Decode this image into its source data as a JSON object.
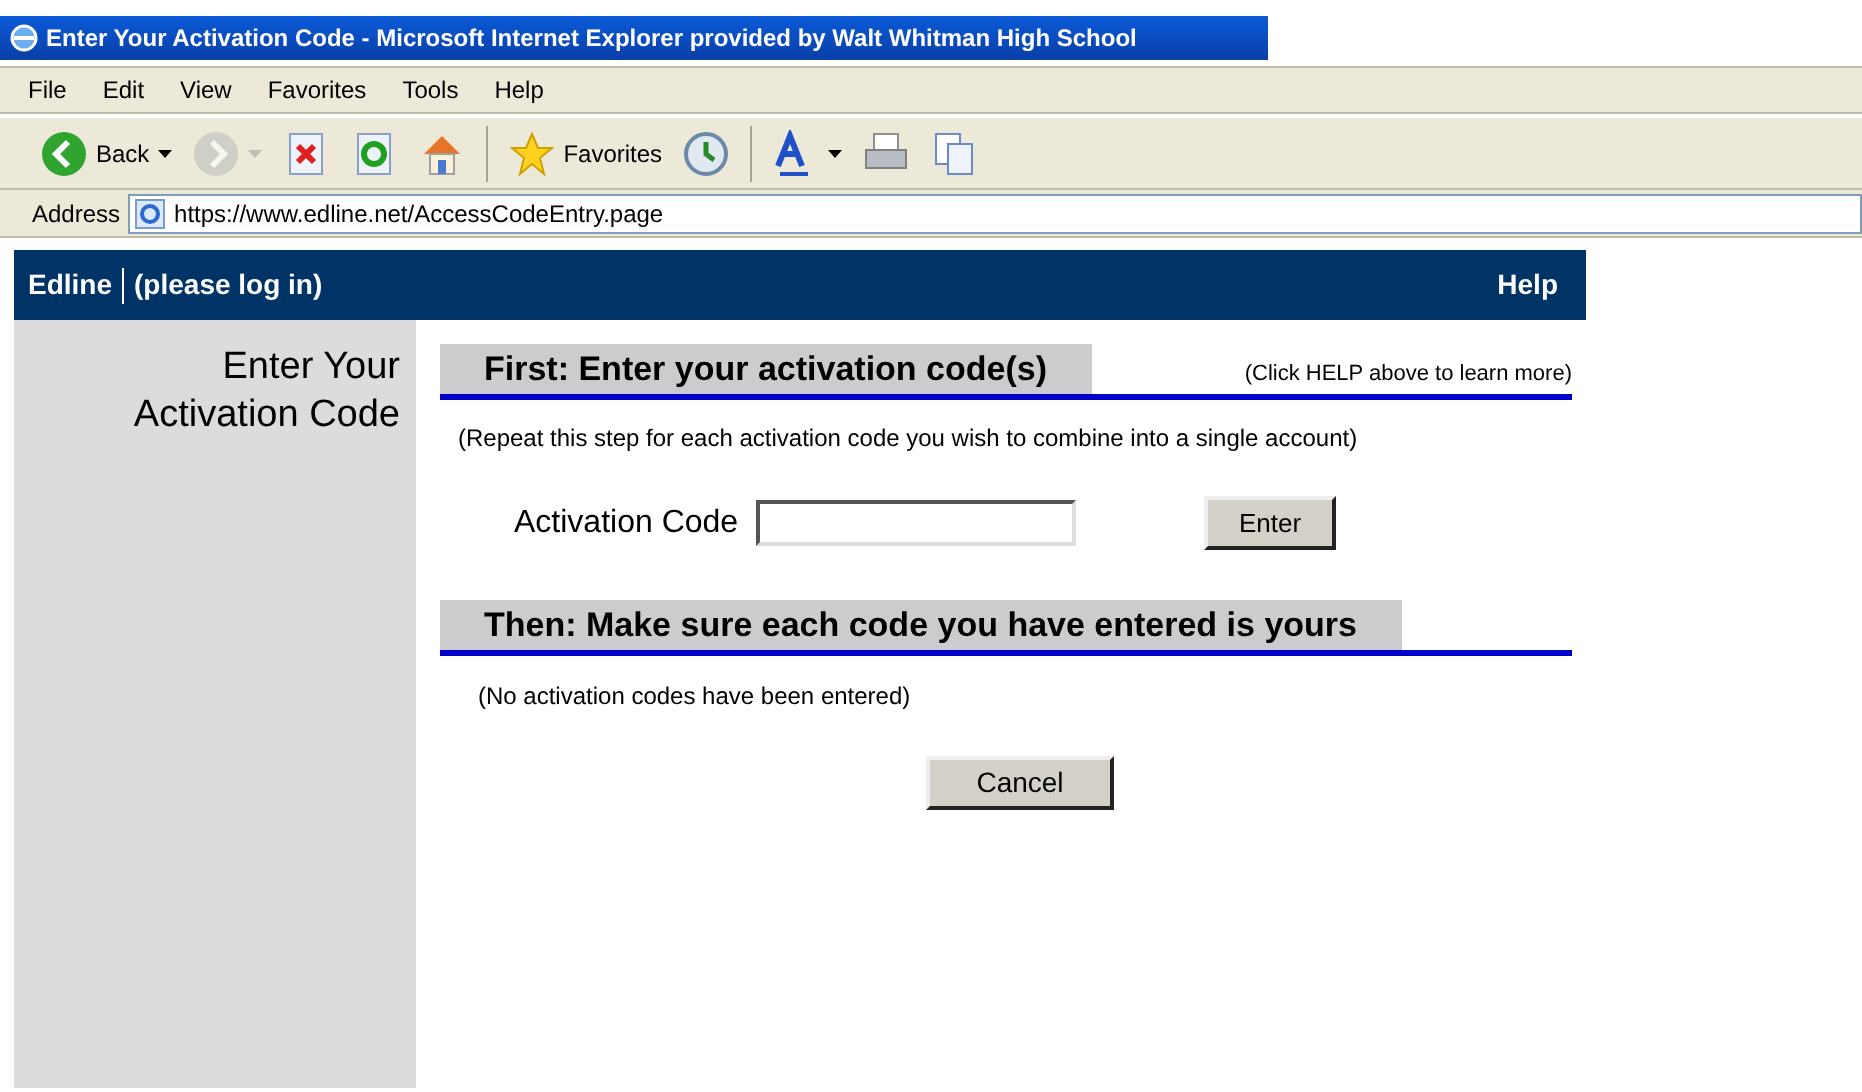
{
  "window": {
    "title": "Enter Your Activation Code - Microsoft Internet Explorer provided by Walt Whitman High School"
  },
  "menu": [
    "File",
    "Edit",
    "View",
    "Favorites",
    "Tools",
    "Help"
  ],
  "toolbar": [
    {
      "kind": "back",
      "label": "Back",
      "disabled": false
    },
    {
      "kind": "forward",
      "disabled": true
    },
    {
      "kind": "stop",
      "disabled": false
    },
    {
      "kind": "refresh",
      "disabled": false
    },
    {
      "kind": "home",
      "disabled": false
    },
    {
      "kind": "favorites",
      "label": "Favorites",
      "disabled": false
    },
    {
      "kind": "history",
      "disabled": false
    },
    {
      "kind": "font",
      "disabled": false
    },
    {
      "kind": "print",
      "disabled": false
    },
    {
      "kind": "copy",
      "disabled": false
    }
  ],
  "address": {
    "label": "Address",
    "url": "https://www.edline.net/AccessCodeEntry.page"
  },
  "header": {
    "brand": "Edline",
    "status": "(please log in)",
    "help": "Help"
  },
  "sidebar": {
    "heading_lines": [
      "Enter Your",
      "Activation Code"
    ]
  },
  "step1": {
    "heading": "First: Enter your activation code(s)",
    "hint": "(Click HELP above to learn more)",
    "note": "(Repeat this step for each activation code you wish to combine into a single account)",
    "field_label": "Activation Code",
    "button": "Enter"
  },
  "step2": {
    "heading": "Then: Make sure each code you have entered is yours",
    "note": "(No activation codes have been entered)"
  },
  "cancel": "Cancel"
}
